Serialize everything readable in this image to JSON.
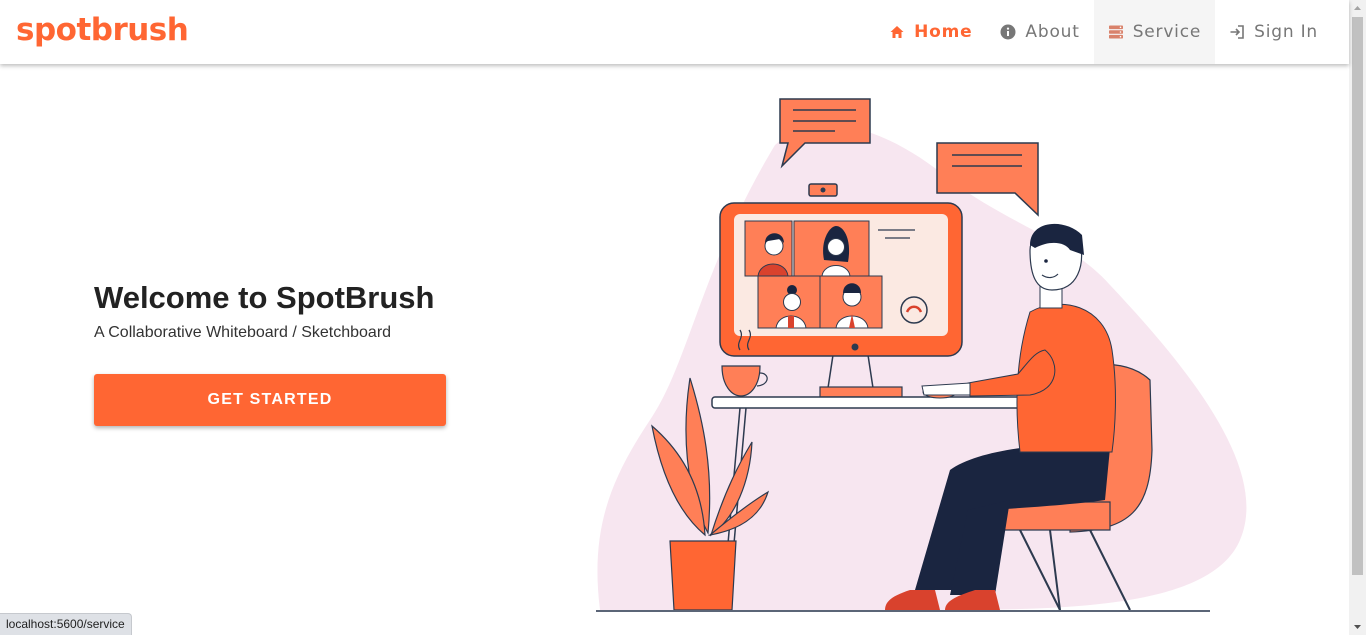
{
  "brand": {
    "logo_text": "spotbrush",
    "accent": "#ff6633"
  },
  "nav": {
    "items": [
      {
        "label": "Home",
        "icon": "home-icon",
        "active": true
      },
      {
        "label": "About",
        "icon": "info-icon",
        "active": false
      },
      {
        "label": "Service",
        "icon": "server-icon",
        "active": false
      },
      {
        "label": "Sign In",
        "icon": "sign-in-icon",
        "active": false
      }
    ]
  },
  "hero": {
    "title": "Welcome to SpotBrush",
    "subtitle": "A Collaborative Whiteboard / Sketchboard",
    "cta_label": "GET STARTED"
  },
  "illustration": {
    "name": "video-conference-illustration"
  },
  "status_bar": {
    "url": "localhost:5600/service"
  }
}
